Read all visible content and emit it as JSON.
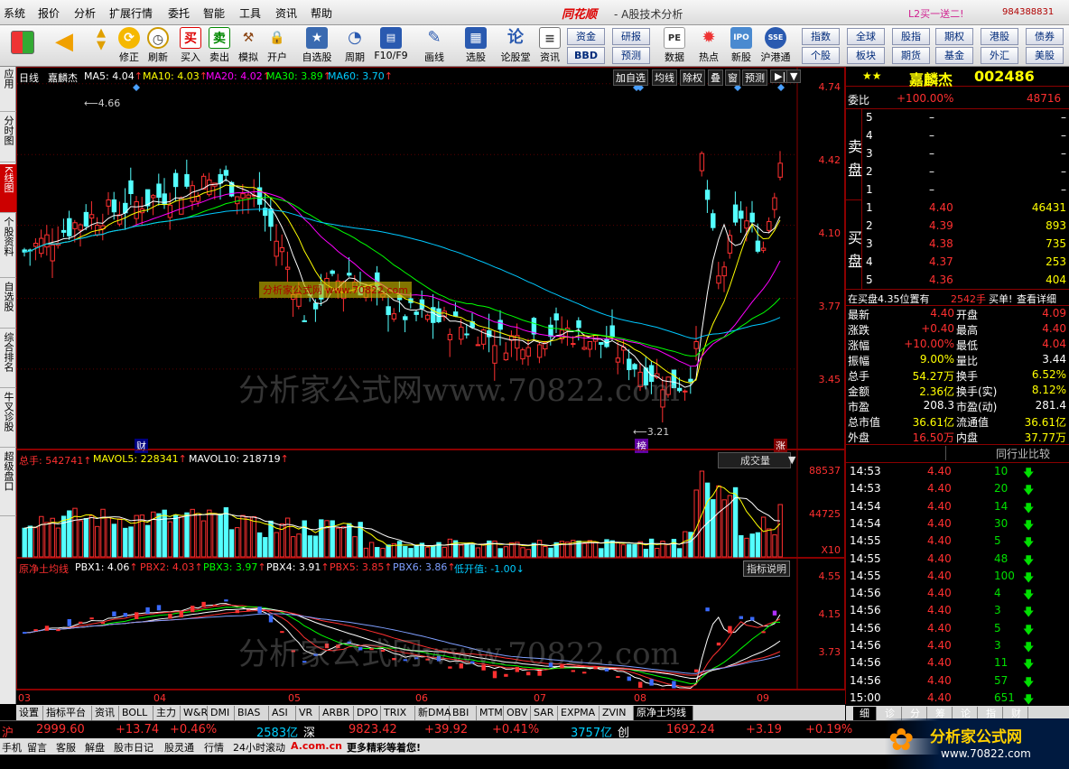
{
  "menu": [
    "系统",
    "报价",
    "分析",
    "扩展行情",
    "委托",
    "智能",
    "工具",
    "资讯",
    "帮助"
  ],
  "brand": "同花顺",
  "window_title": "- A股技术分析",
  "promo": "L2买一送二!",
  "account": "984388831",
  "toolbar": [
    "修正",
    "刷新",
    "买入",
    "卖出",
    "模拟",
    "开户",
    "自选股",
    "周期",
    "F10/F9",
    "画线",
    "选股",
    "论股堂",
    "资讯",
    "数据",
    "热点",
    "新股",
    "沪港通"
  ],
  "quick_buttons": [
    [
      "资金",
      "研报"
    ],
    [
      "BBD",
      "预测"
    ]
  ],
  "right_buttons": [
    [
      "指数",
      "全球",
      "股指",
      "期权",
      "港股",
      "债券"
    ],
    [
      "个股",
      "板块",
      "期货",
      "基金",
      "外汇",
      "美股"
    ]
  ],
  "left_tabs": [
    "应用",
    "分时图",
    "K线图",
    "个股资料",
    "自选股",
    "综合排名",
    "牛叉诊股",
    "超级盘口"
  ],
  "main_chart": {
    "period": "日线",
    "stock": "嘉麟杰",
    "ma": [
      {
        "label": "MA5: 4.04",
        "color": "#ffffff"
      },
      {
        "label": "MA10: 4.03",
        "color": "#ffff00"
      },
      {
        "label": "MA20: 4.02",
        "color": "#ff00ff"
      },
      {
        "label": "MA30: 3.89",
        "color": "#00ff00"
      },
      {
        "label": "MA60: 3.70",
        "color": "#00c8ff"
      }
    ],
    "buttons": [
      "加自选",
      "均线",
      "除权",
      "叠",
      "窗",
      "预测"
    ],
    "axis": [
      "4.74",
      "4.42",
      "4.10",
      "3.77",
      "3.45"
    ],
    "high_mark": "4.66",
    "low_mark": "3.21",
    "markers": [
      "财",
      "榜",
      "涨"
    ]
  },
  "volume_chart": {
    "labels": [
      {
        "label": "总手: 542741",
        "color": "#ff3030"
      },
      {
        "label": "MAVOL5: 228341",
        "color": "#ffff00"
      },
      {
        "label": "MAVOL10: 218719",
        "color": "#ffffff"
      }
    ],
    "dropdown": "成交量",
    "axis": [
      "88537",
      "44725"
    ],
    "unit": "X10"
  },
  "indicator_chart": {
    "labels": [
      {
        "label": "原净土均线",
        "color": "#ff3030"
      },
      {
        "label": "PBX1: 4.06",
        "color": "#ffffff"
      },
      {
        "label": "PBX2: 4.03",
        "color": "#ff3030"
      },
      {
        "label": "PBX3: 3.97",
        "color": "#00ff00"
      },
      {
        "label": "PBX4: 3.91",
        "color": "#ffffff"
      },
      {
        "label": "PBX5: 3.85",
        "color": "#ff3030"
      },
      {
        "label": "PBX6: 3.86",
        "color": "#7f9fff"
      },
      {
        "label": "低开值: -1.00",
        "color": "#00c8ff"
      }
    ],
    "help": "指标说明",
    "axis": [
      "4.55",
      "4.15",
      "3.73"
    ]
  },
  "months": [
    "03",
    "04",
    "05",
    "06",
    "07",
    "08",
    "09"
  ],
  "watermark": "分析家公式网www.70822.com",
  "watermark_small": "分析家公式网 www.70822.com",
  "bottom_tabs": [
    "设置",
    "指标平台",
    "资讯",
    "BOLL",
    "主力",
    "W&R",
    "DMI",
    "BIAS",
    "ASI",
    "VR",
    "ARBR",
    "DPO",
    "TRIX",
    "新DMA",
    "BBI",
    "MTM",
    "OBV",
    "SAR",
    "EXPMA",
    "ZVIN",
    "原净土均线"
  ],
  "right_panel": {
    "stars": "★★",
    "name": "嘉麟杰",
    "code": "002486",
    "weibi_label": "委比",
    "weibi": "+100.00%",
    "weibi_vol": "48716",
    "sell_label": "卖盘",
    "sell": [
      [
        "5",
        "–",
        "–"
      ],
      [
        "4",
        "–",
        "–"
      ],
      [
        "3",
        "–",
        "–"
      ],
      [
        "2",
        "–",
        "–"
      ],
      [
        "1",
        "–",
        "–"
      ]
    ],
    "buy_label": "买盘",
    "buy": [
      [
        "1",
        "4.40",
        "46431"
      ],
      [
        "2",
        "4.39",
        "893"
      ],
      [
        "3",
        "4.38",
        "735"
      ],
      [
        "4",
        "4.37",
        "253"
      ],
      [
        "5",
        "4.36",
        "404"
      ]
    ],
    "notice": "在买盘4.35位置有",
    "notice_vol": "2542手",
    "notice_action": "买单!",
    "notice_link": "查看详细",
    "stats": [
      [
        "最新",
        "4.40",
        "开盘",
        "4.09"
      ],
      [
        "涨跌",
        "+0.40",
        "最高",
        "4.40"
      ],
      [
        "涨幅",
        "+10.00%",
        "最低",
        "4.04"
      ],
      [
        "振幅",
        "9.00%",
        "量比",
        "3.44"
      ],
      [
        "总手",
        "54.27万",
        "换手",
        "6.52%"
      ],
      [
        "金额",
        "2.36亿",
        "换手(实)",
        "8.12%"
      ],
      [
        "市盈",
        "208.3",
        "市盈(动)",
        "281.4"
      ],
      [
        "总市值",
        "36.61亿",
        "流通值",
        "36.61亿"
      ],
      [
        "外盘",
        "16.50万",
        "内盘",
        "37.77万"
      ]
    ],
    "compare": "同行业比较",
    "ticks": [
      [
        "14:53",
        "4.40",
        "10"
      ],
      [
        "14:53",
        "4.40",
        "20"
      ],
      [
        "14:54",
        "4.40",
        "14"
      ],
      [
        "14:54",
        "4.40",
        "30"
      ],
      [
        "14:55",
        "4.40",
        "5"
      ],
      [
        "14:55",
        "4.40",
        "48"
      ],
      [
        "14:55",
        "4.40",
        "100"
      ],
      [
        "14:56",
        "4.40",
        "4"
      ],
      [
        "14:56",
        "4.40",
        "3"
      ],
      [
        "14:56",
        "4.40",
        "5"
      ],
      [
        "14:56",
        "4.40",
        "3"
      ],
      [
        "14:56",
        "4.40",
        "11"
      ],
      [
        "14:56",
        "4.40",
        "57"
      ],
      [
        "15:00",
        "4.40",
        "651"
      ]
    ],
    "tabs": [
      "细",
      "诊",
      "分",
      "筹",
      "论",
      "指",
      "财"
    ]
  },
  "index_bar": {
    "sh_label": "沪",
    "sh_val": "2999.60",
    "sh_chg": "+13.74",
    "sh_pct": "+0.46%",
    "sh_amt": "2583亿",
    "sz_label": "深",
    "sz_val": "9823.42",
    "sz_chg": "+39.92",
    "sz_pct": "+0.41%",
    "sz_amt": "3757亿",
    "cy_label": "创",
    "cy_val": "1692.24",
    "cy_chg": "+3.19",
    "cy_pct": "+0.19%"
  },
  "info_bar": [
    "手机",
    "留言",
    "客服",
    "解盘",
    "股市日记",
    "股灵通",
    "行情",
    "24小时滚动",
    "A.com.cn",
    "更多精彩等着您!"
  ],
  "logo_text": "分析家公式网",
  "logo_url": "www.70822.com"
}
